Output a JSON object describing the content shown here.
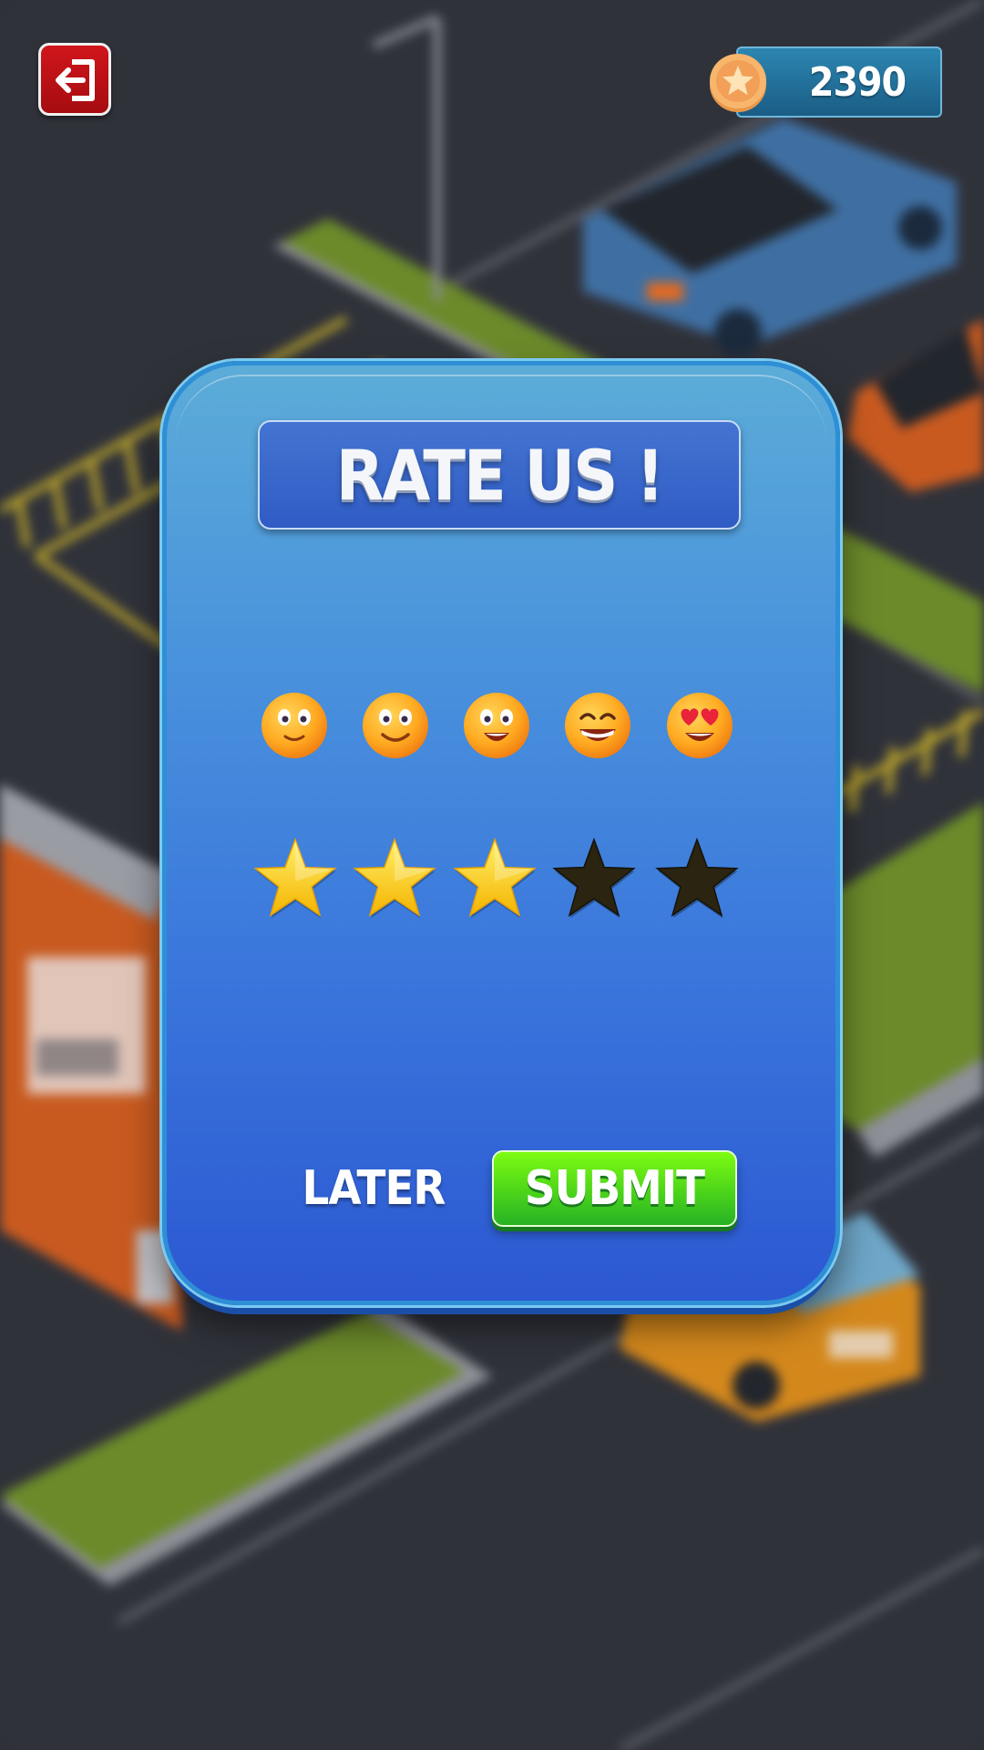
{
  "hud": {
    "coins": "2390"
  },
  "dialog": {
    "title": "RATE US !",
    "later_label": "LATER",
    "submit_label": "SUBMIT"
  },
  "rating": {
    "value": 3,
    "max": 5,
    "faces": [
      "slight-smile-face-icon",
      "smile-face-icon",
      "grin-face-icon",
      "big-grin-face-icon",
      "heart-eyes-face-icon"
    ]
  },
  "colors": {
    "panel_top": "#5cacd8",
    "panel_bottom": "#2c58d2",
    "submit_green": "#4cd41a",
    "exit_red": "#c01218",
    "star_filled": "#ffd21e",
    "star_empty": "#2a2410"
  }
}
